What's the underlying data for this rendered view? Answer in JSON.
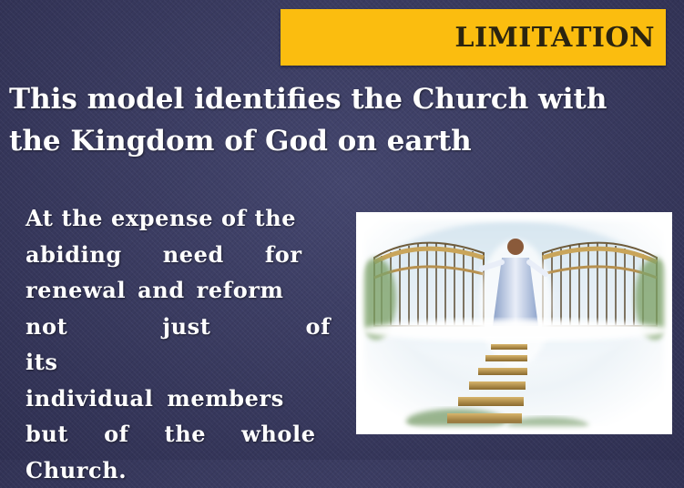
{
  "slide": {
    "title": "LIMITATION",
    "headline_lines": [
      "This model identifies the Church with",
      "the Kingdom of God on earth"
    ],
    "body_lines": [
      "At the expense of the",
      "abiding need for",
      "renewal and reform",
      "not just of its",
      "individual members",
      "but of the whole",
      "Church."
    ],
    "image": {
      "subject": "heaven-gate-picture"
    }
  },
  "colors": {
    "background": "#393a60",
    "banner": "#fbbd0f",
    "title_text": "#2b2410",
    "body_text": "#ffffff"
  }
}
